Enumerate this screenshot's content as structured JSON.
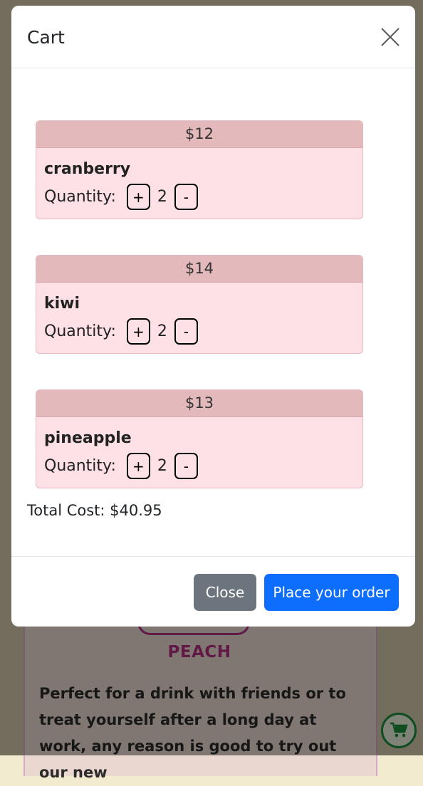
{
  "background": {
    "product_title": "PEACH",
    "product_description": "Perfect for a drink with friends or to treat yourself after a long day at work, any reason is good to try out our new",
    "cart_icon": "shopping-cart-icon"
  },
  "modal": {
    "title": "Cart",
    "close_icon": "close-icon",
    "items": [
      {
        "price": "$12",
        "name": "cranberry",
        "quantity_label": "Quantity:",
        "plus": "+",
        "quantity": "2",
        "minus": "-"
      },
      {
        "price": "$14",
        "name": "kiwi",
        "quantity_label": "Quantity:",
        "plus": "+",
        "quantity": "2",
        "minus": "-"
      },
      {
        "price": "$13",
        "name": "pineapple",
        "quantity_label": "Quantity:",
        "plus": "+",
        "quantity": "2",
        "minus": "-"
      }
    ],
    "total": "Total Cost: $40.95",
    "footer": {
      "close_label": "Close",
      "order_label": "Place your order"
    }
  },
  "colors": {
    "primary": "#0d6efd",
    "secondary": "#6c757d",
    "item_header": "#e3b9bb",
    "item_body": "#fde1e7",
    "accent": "#b0307f"
  }
}
